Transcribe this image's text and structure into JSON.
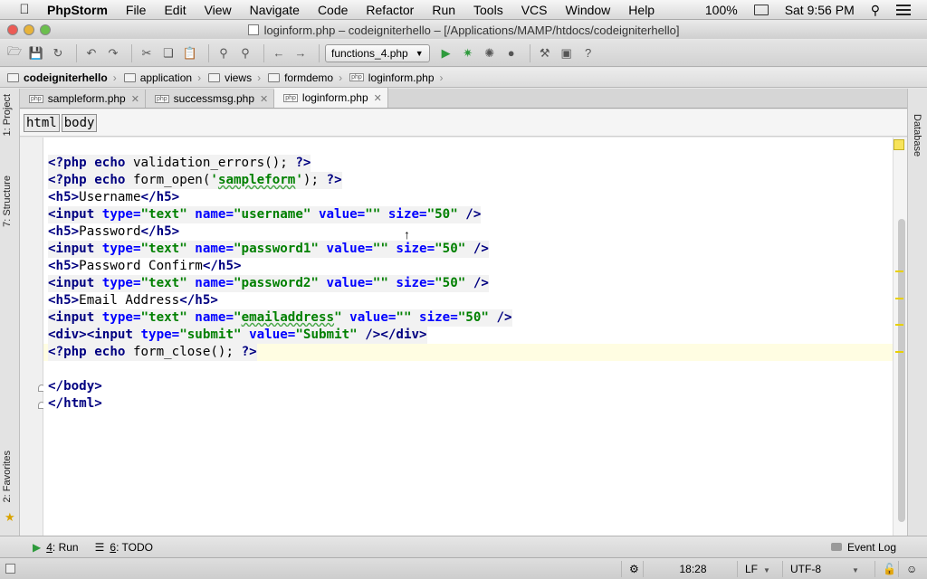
{
  "menubar": {
    "apple_icon": "apple-icon",
    "app_name": "PhpStorm",
    "items": [
      "File",
      "Edit",
      "View",
      "Navigate",
      "Code",
      "Refactor",
      "Run",
      "Tools",
      "VCS",
      "Window",
      "Help"
    ],
    "battery": "100%",
    "clock": "Sat 9:56 PM"
  },
  "window": {
    "title": "loginform.php – codeigniterhello – [/Applications/MAMP/htdocs/codeigniterhello]"
  },
  "toolbar": {
    "run_config": "functions_4.php"
  },
  "navbar": {
    "crumbs": [
      "codeigniterhello",
      "application",
      "views",
      "formdemo",
      "loginform.php"
    ]
  },
  "editor_tabs": [
    {
      "label": "sampleform.php"
    },
    {
      "label": "successmsg.php"
    },
    {
      "label": "loginform.php"
    }
  ],
  "tag_crumbs": [
    "html",
    "body"
  ],
  "tool_windows": {
    "left_top": [
      "1: Project",
      "7: Structure"
    ],
    "left_bottom": "2: Favorites",
    "right": "Database"
  },
  "code": {
    "l1": {
      "a": "<?php echo ",
      "b": "validation_errors(); ",
      "c": "?>"
    },
    "l2": {
      "a": "<?php echo ",
      "b": "form_open(",
      "c": "'",
      "d": "sampleform",
      "e": "'",
      "f": "); ",
      "g": "?>"
    },
    "l3": {
      "a": "<h5>",
      "b": "Username",
      "c": "</h5>"
    },
    "l4": {
      "a": "<input ",
      "b": "type=",
      "c": "\"text\"",
      "d": " name=",
      "e": "\"username\"",
      "f": " value=",
      "g": "\"\"",
      "h": " size=",
      "i": "\"50\"",
      "j": " />"
    },
    "l5": {
      "a": "<h5>",
      "b": "Password",
      "c": "</h5>"
    },
    "l6": {
      "a": "<input ",
      "b": "type=",
      "c": "\"text\"",
      "d": " name=",
      "e": "\"password1\"",
      "f": " value=",
      "g": "\"\"",
      "h": " size=",
      "i": "\"50\"",
      "j": " />"
    },
    "l7": {
      "a": "<h5>",
      "b": "Password Confirm",
      "c": "</h5>"
    },
    "l8": {
      "a": "<input ",
      "b": "type=",
      "c": "\"text\"",
      "d": " name=",
      "e": "\"password2\"",
      "f": " value=",
      "g": "\"\"",
      "h": " size=",
      "i": "\"50\"",
      "j": " />"
    },
    "l9": {
      "a": "<h5>",
      "b": "Email Address",
      "c": "</h5>"
    },
    "l10": {
      "a": "<input ",
      "b": "type=",
      "c": "\"text\"",
      "d": " name=",
      "e1": "\"",
      "e2": "emailaddress",
      "e3": "\"",
      "f": " value=",
      "g": "\"\"",
      "h": " size=",
      "i": "\"50\"",
      "j": " />"
    },
    "l11": {
      "a": "<div><input ",
      "b": "type=",
      "c": "\"submit\"",
      "d": " value=",
      "e": "\"Submit\"",
      "f": " /></div>"
    },
    "l12": {
      "a": "<?php echo ",
      "b": "form_close(); ",
      "c": "?>"
    },
    "l14": "</body>",
    "l15": "</html>"
  },
  "bottom_tools": {
    "run_num": "4",
    "run_label": ": Run",
    "todo_num": "6",
    "todo_label": ": TODO",
    "event_log": "Event Log"
  },
  "statusbar": {
    "position": "18:28",
    "line_sep": "LF",
    "encoding": "UTF-8"
  }
}
